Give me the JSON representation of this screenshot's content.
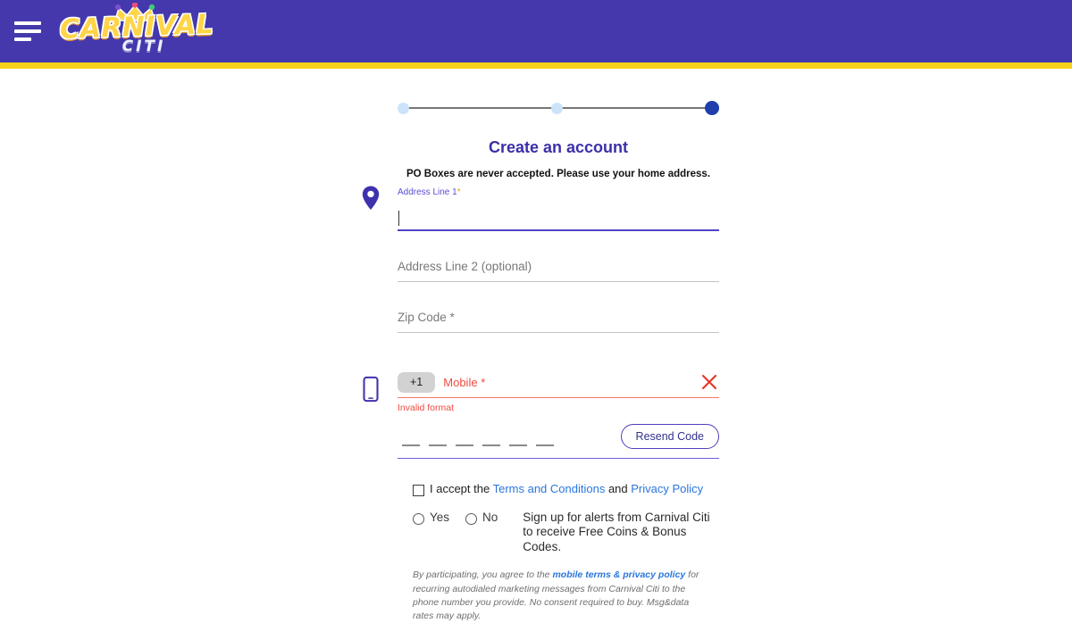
{
  "header": {
    "menu_icon": "hamburger-icon",
    "logo_main": "CARNIVAL",
    "logo_sub": "CITI"
  },
  "stepper": {
    "steps": [
      {
        "state": "inactive"
      },
      {
        "state": "inactive"
      },
      {
        "state": "active"
      }
    ]
  },
  "form": {
    "title": "Create an account",
    "po_note": "PO Boxes are never accepted. Please use your home address.",
    "address1": {
      "label": "Address Line 1",
      "required_mark": "*",
      "value": "",
      "icon": "map-pin-icon"
    },
    "address2": {
      "placeholder": "Address Line 2 (optional)",
      "value": ""
    },
    "zip": {
      "placeholder": "Zip Code *",
      "value": ""
    },
    "mobile": {
      "icon": "mobile-phone-icon",
      "country_code": "+1",
      "label": "Mobile",
      "required_mark": "*",
      "value": "",
      "error": "Invalid format",
      "clear_icon": "close-x-icon"
    },
    "otp": {
      "dashes": [
        "",
        "",
        "",
        "",
        "",
        ""
      ],
      "resend_label": "Resend Code"
    }
  },
  "consent": {
    "accept_prefix": "I accept the ",
    "terms_link": "Terms and Conditions",
    "accept_join": " and ",
    "privacy_link": "Privacy Policy",
    "yes_label": "Yes",
    "no_label": "No",
    "alerts_text": "Sign up for alerts from Carnival Citi to receive Free Coins & Bonus Codes.",
    "fineprint_pre": "By participating, you agree to the ",
    "fineprint_link": "mobile terms & privacy policy",
    "fineprint_post": " for recurring autodialed marketing messages from Carnival Citi to the phone number you provide. No consent required to buy. Msg&data rates may apply."
  },
  "colors": {
    "header_purple": "#4438ac",
    "accent_yellow": "#f7d119",
    "title_indigo": "#3b2fa8",
    "error_red": "#f04a3f",
    "link_blue": "#2a76dd",
    "active_step": "#1f3fad",
    "inactive_step": "#cde3fa"
  }
}
